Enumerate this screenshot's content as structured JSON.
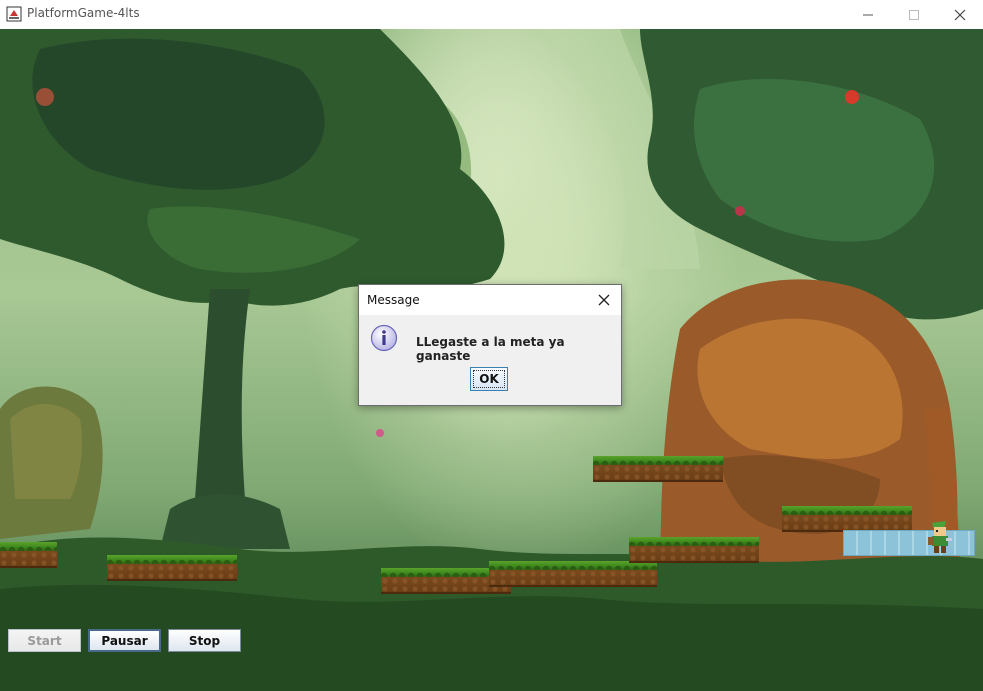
{
  "window": {
    "title": "PlatformGame-4lts",
    "icons": {
      "app": "java-cup-icon",
      "minimize": "minimize-icon",
      "maximize": "maximize-icon",
      "close": "close-icon"
    }
  },
  "controls": {
    "start_label": "Start",
    "pause_label": "Pausar",
    "stop_label": "Stop"
  },
  "dialog": {
    "title": "Message",
    "message": "LLegaste a la meta ya ganaste",
    "ok_label": "OK",
    "icon": "info-icon"
  },
  "colors": {
    "grass": "#3f8a1e",
    "dirt": "#6a3c14",
    "goal": "#98cde0",
    "dialog_button_border": "#3c7fb1"
  }
}
